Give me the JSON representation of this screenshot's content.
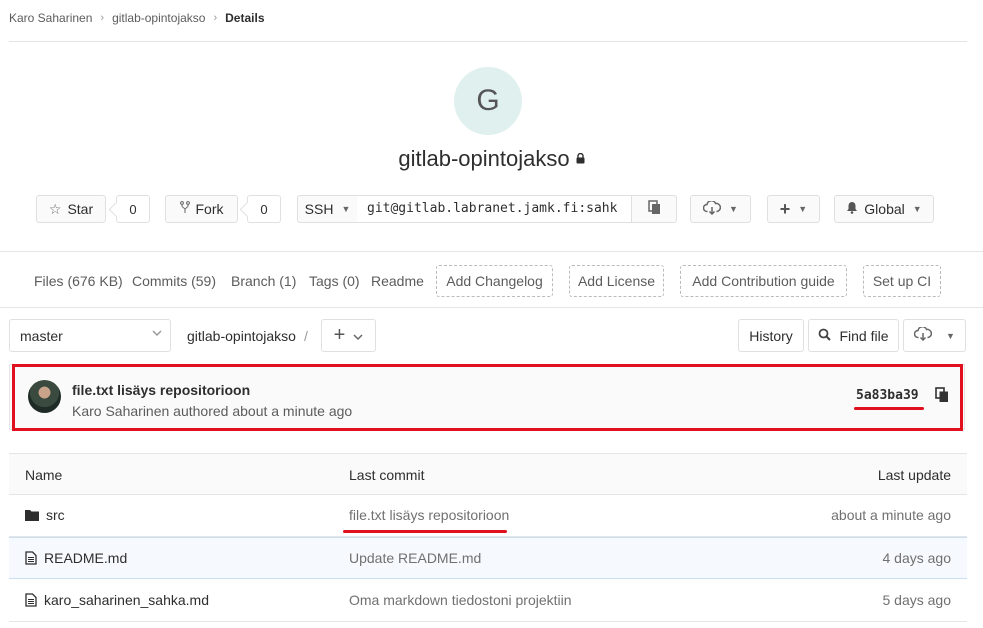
{
  "breadcrumb": {
    "owner": "Karo Saharinen",
    "project": "gitlab-opintojakso",
    "current": "Details"
  },
  "project": {
    "avatar_letter": "G",
    "name": "gitlab-opintojakso",
    "visibility_icon": "lock-icon"
  },
  "actions": {
    "star_label": "Star",
    "star_count": "0",
    "fork_label": "Fork",
    "fork_count": "0",
    "clone_protocol": "SSH",
    "clone_url": "git@gitlab.labranet.jamk.fi:sahk",
    "notification_label": "Global"
  },
  "stats": {
    "files": "Files (676 KB)",
    "commits": "Commits (59)",
    "branch": "Branch (1)",
    "tags": "Tags (0)",
    "readme": "Readme",
    "add_changelog": "Add Changelog",
    "add_license": "Add License",
    "add_contribution": "Add Contribution guide",
    "setup_ci": "Set up CI"
  },
  "tree": {
    "branch": "master",
    "path": "gitlab-opintojakso",
    "path_sep": "/",
    "history_label": "History",
    "find_file_label": "Find file"
  },
  "last_commit": {
    "title": "file.txt lisäys repositorioon",
    "meta": "Karo Saharinen authored about a minute ago",
    "sha": "5a83ba39"
  },
  "table": {
    "headers": {
      "name": "Name",
      "last_commit": "Last commit",
      "last_update": "Last update"
    },
    "rows": [
      {
        "name": "src",
        "type": "folder",
        "commit": "file.txt lisäys repositorioon",
        "updated": "about a minute ago"
      },
      {
        "name": "README.md",
        "type": "file",
        "commit": "Update README.md",
        "updated": "4 days ago"
      },
      {
        "name": "karo_saharinen_sahka.md",
        "type": "file",
        "commit": "Oma markdown tiedostoni projektiin",
        "updated": "5 days ago"
      }
    ]
  },
  "colors": {
    "highlight_red": "#e0101e",
    "avatar_bg": "#e0f0ef"
  }
}
